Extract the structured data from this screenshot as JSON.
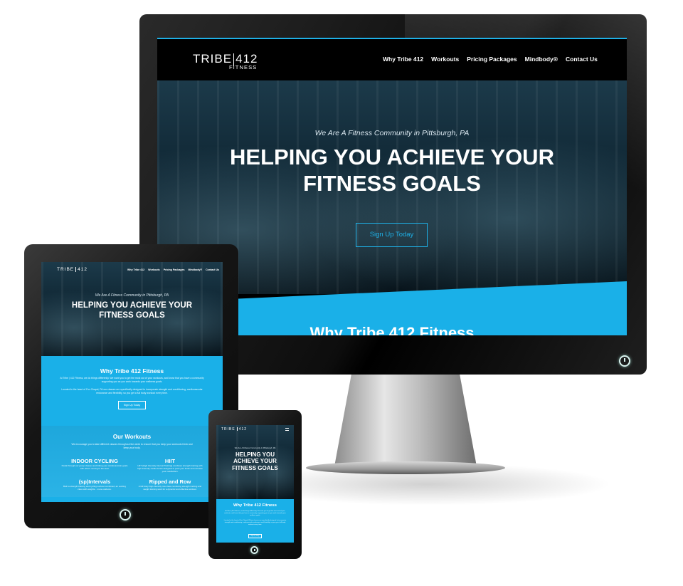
{
  "brand": {
    "name": "TRIBE",
    "number": "412",
    "sub": "FITNESS"
  },
  "nav": [
    "Why Tribe 412",
    "Workouts",
    "Pricing Packages",
    "Mindbody®",
    "Contact Us"
  ],
  "hero": {
    "tagline": "We Are A Fitness Community in Pittsburgh, PA",
    "headline_line1": "HELPING YOU ACHIEVE YOUR",
    "headline_line2": "FITNESS GOALS",
    "tablet_line1": "HELPING YOU ACHIEVE YOUR",
    "tablet_line2": "FITNESS GOALS",
    "phone_line1": "HELPING YOU",
    "phone_line2": "ACHIEVE YOUR",
    "phone_line3": "FITNESS GOALS",
    "cta": "Sign Up Today"
  },
  "why": {
    "title": "Why Tribe 412 Fitness",
    "p1": "At Tribe | 412 Fitness, we do things differently. We want you to get the most out of your workouts, and know that you have a community supporting you as you work towards your wellness goals.",
    "p2": "Located in the heart of Fox Chapel, PA our classes are specifically designed to incorporate strength and conditioning, cardiovascular endurance and flexibility, so you get a full body workout every time.",
    "cta": "Sign Up Today"
  },
  "workouts": {
    "title": "Our Workouts",
    "intro": "We encourage you to take different classes throughout the week to ensure that you keep your workouts fresh and keep your body.",
    "items": [
      {
        "name": "INDOOR CYCLING",
        "desc": "Pedal through our group classes and hitting your cardiovascular goals with others moving to the beat."
      },
      {
        "name": "HIIT",
        "desc": "HIIT (High Intensity Interval Training) combines strength training with high intensity cardio bursts designed to push your limits and increase your metabolism."
      },
      {
        "name": "(sp)Intervals",
        "desc": "Both a strength training and cycling workout combined, an exciting class with weights... more outdoors."
      },
      {
        "name": "Ripped and Row",
        "desc": "A full body high-intensity row class combining strength training and weight training work for a dynamic and effective workout."
      }
    ]
  },
  "colors": {
    "accent": "#1ab0e8",
    "screen": "#000000",
    "text": "#ffffff"
  },
  "icons": {
    "power": "power-icon"
  }
}
